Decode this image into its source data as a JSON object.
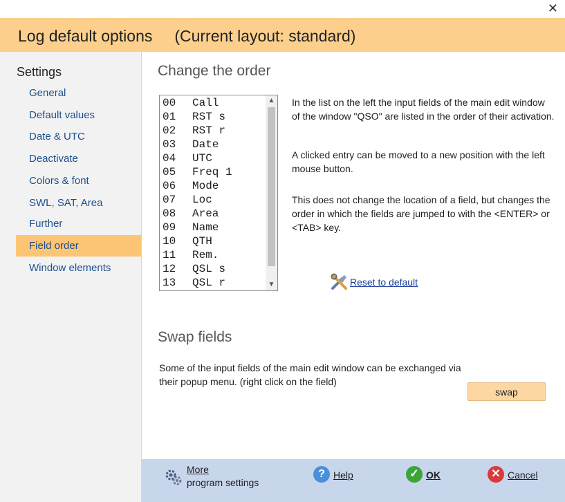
{
  "window": {
    "close_glyph": "✕"
  },
  "header": {
    "title": "Log default options     (Current layout: standard)"
  },
  "sidebar": {
    "heading": "Settings",
    "items": [
      {
        "label": "General"
      },
      {
        "label": "Default values"
      },
      {
        "label": "Date & UTC"
      },
      {
        "label": "Deactivate"
      },
      {
        "label": "Colors & font"
      },
      {
        "label": "SWL, SAT, Area"
      },
      {
        "label": "Further"
      },
      {
        "label": "Field order",
        "active": true
      },
      {
        "label": "Window elements"
      }
    ]
  },
  "order_section": {
    "title": "Change the order",
    "fields": [
      {
        "num": "00",
        "name": "Call"
      },
      {
        "num": "01",
        "name": "RST s"
      },
      {
        "num": "02",
        "name": "RST r"
      },
      {
        "num": "03",
        "name": "Date"
      },
      {
        "num": "04",
        "name": "UTC"
      },
      {
        "num": "05",
        "name": "Freq 1"
      },
      {
        "num": "06",
        "name": "Mode"
      },
      {
        "num": "07",
        "name": "Loc"
      },
      {
        "num": "08",
        "name": "Area"
      },
      {
        "num": "09",
        "name": "Name"
      },
      {
        "num": "10",
        "name": "QTH"
      },
      {
        "num": "11",
        "name": "Rem."
      },
      {
        "num": "12",
        "name": "QSL s"
      },
      {
        "num": "13",
        "name": "QSL r"
      }
    ],
    "desc1": "In the list on the left the input fields of the main edit window of the window \"QSO\" are listed in the order of their activation.",
    "desc2": "A clicked entry can be moved to a new position with the left mouse button.",
    "desc3": "This does not change the location of a field, but changes the order in which the fields are jumped to with the <ENTER> or <TAB> key.",
    "reset_label": "Reset to default"
  },
  "swap_section": {
    "title": "Swap fields",
    "text_line1": "Some of the input fields of the main edit window can be exchanged via",
    "text_line2": "their popup menu. (right click on the field)",
    "swap_label": "swap"
  },
  "footer": {
    "more_line1": "More",
    "more_line2": "program settings",
    "help_label": "Help",
    "ok_label": "OK",
    "cancel_label": "Cancel"
  },
  "colors": {
    "header_bg": "#fcd08c",
    "active_item_bg": "#fcc574",
    "footer_bg": "#c8d6ec",
    "link": "#1a3c9b"
  }
}
